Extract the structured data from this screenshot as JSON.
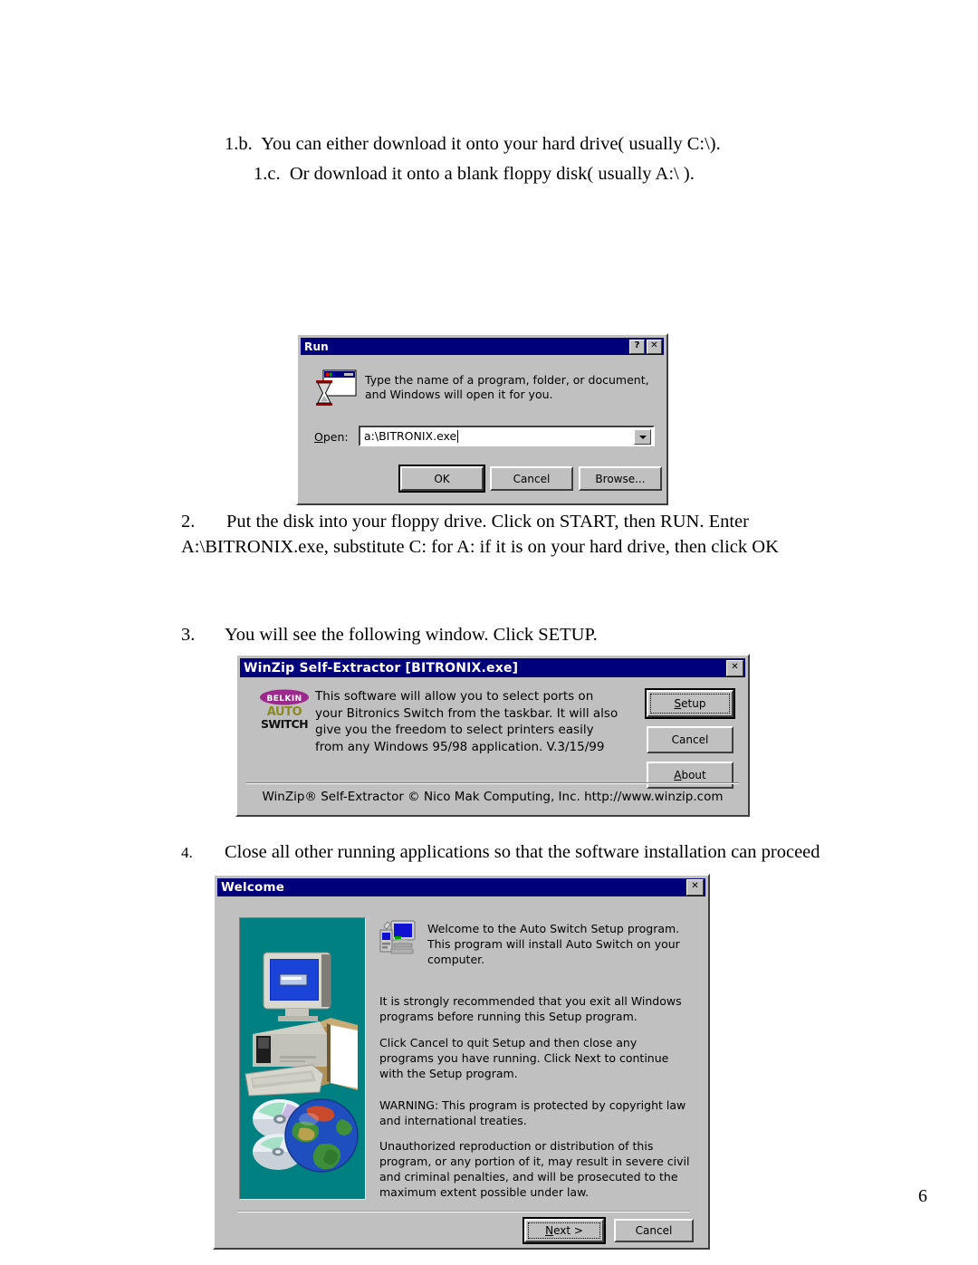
{
  "document": {
    "page_number": "6",
    "lines": [
      {
        "text": "1.b.  You can either download it onto your hard drive( usually C:\\)."
      },
      {
        "text": "1.c.  Or download it onto a blank floppy disk( usually A:\\ )."
      }
    ],
    "step2": {
      "number": "2.",
      "text": "Put the disk into your floppy drive. Click on START, then RUN.  Enter A:\\BITRONIX.exe, substitute C: for A: if it is on your hard drive, then click OK"
    },
    "step3": {
      "number": "3.",
      "text": "You will see the following window.  Click SETUP."
    },
    "step4": {
      "number": "4.",
      "text": "Close all other running applications so that the software installation can proceed"
    }
  },
  "run_dialog": {
    "title": "Run",
    "icon": "run-hourglass-window-icon",
    "help_button": "?",
    "close_button": "✕",
    "prompt": "Type the name of a program, folder, or document, and Windows will open it for you.",
    "open_label": "Open:",
    "open_value": "a:\\BITRONIX.exe",
    "buttons": {
      "ok": "OK",
      "cancel": "Cancel",
      "browse": "Browse..."
    }
  },
  "winzip_dialog": {
    "title": "WinZip Self-Extractor [BITRONIX.exe]",
    "close_button": "✕",
    "logo": {
      "brand": "BELKIN",
      "line2": "AUTO",
      "line3": "SWITCH",
      "brand_color": "#9c2a8c",
      "auto_color": "#8a8a22"
    },
    "body": "This software will allow you to select ports on your Bitronics Switch from the taskbar.  It will also give you the freedom to select printers easily from any Windows 95/98 application.  V.3/15/99",
    "buttons": {
      "setup": "Setup",
      "cancel": "Cancel",
      "about": "About"
    },
    "footer": "WinZip® Self-Extractor  © Nico Mak Computing, Inc.  http://www.winzip.com"
  },
  "welcome_dialog": {
    "title": "Welcome",
    "close_button": "✕",
    "artwork": "computer-cd-globe-artwork",
    "setup_icon": "setup-computer-icon",
    "heading": "Welcome to the Auto Switch Setup program.  This program will install Auto Switch on your computer.",
    "paragraph1": "It is strongly recommended that you exit all Windows programs before running this Setup program.",
    "paragraph2": "Click Cancel to quit Setup and then close any programs you have running.  Click Next to continue with the Setup program.",
    "paragraph3": "WARNING: This program is protected by copyright law and international treaties.",
    "paragraph4": "Unauthorized reproduction or distribution of this program, or any portion of it, may result in severe civil and criminal penalties, and will be prosecuted to the maximum extent possible under law.",
    "buttons": {
      "next": "Next >",
      "cancel": "Cancel"
    }
  },
  "colors": {
    "titlebar": "#00007b",
    "dialog_face": "#c0c0c0",
    "artwork_teal": "#008080",
    "page_background": "#ffffff"
  }
}
